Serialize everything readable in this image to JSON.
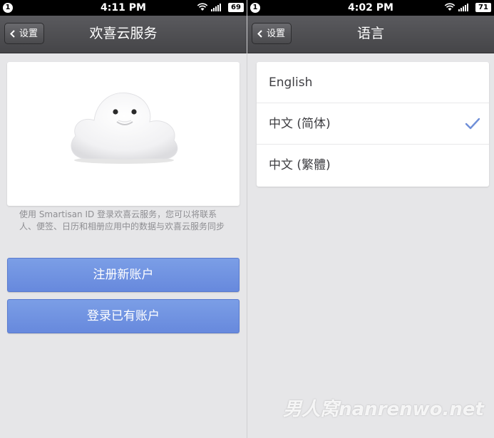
{
  "left": {
    "status": {
      "badge": "1",
      "time": "4:11 PM",
      "battery": "69"
    },
    "nav": {
      "back_label": "设置",
      "title": "欢喜云服务"
    },
    "description": "使用 Smartisan ID 登录欢喜云服务，您可以将联系人、便签、日历和相册应用中的数据与欢喜云服务同步",
    "buttons": {
      "register": "注册新账户",
      "login": "登录已有账户"
    }
  },
  "right": {
    "status": {
      "badge": "1",
      "time": "4:02 PM",
      "battery": "71"
    },
    "nav": {
      "back_label": "设置",
      "title": "语言"
    },
    "languages": [
      {
        "label": "English",
        "selected": false
      },
      {
        "label": "中文 (简体)",
        "selected": true
      },
      {
        "label": "中文 (繁體)",
        "selected": false
      }
    ]
  },
  "watermark": "男人窝nanrenwo.net",
  "colors": {
    "accent_blue": "#6f92e2",
    "nav_bar": "#4f4f52",
    "check": "#6f8fd8"
  }
}
